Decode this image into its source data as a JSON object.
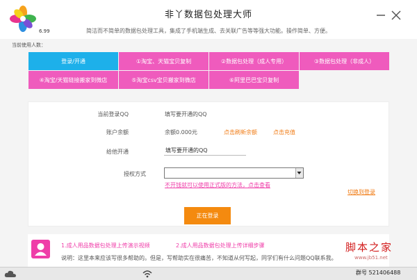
{
  "header": {
    "title": "非丫数据包处理大师",
    "version": "6.99",
    "subtitle": "简洁而不简单的数据包处理工具，集成了手机端生成、去关联广告等等强大功能。操作简单、方便。"
  },
  "online_users_label": "当前使用人数：",
  "tabs": [
    {
      "label": "登录/开通"
    },
    {
      "label": "①淘宝、天猫宝贝复制"
    },
    {
      "label": "②数据包处理（成人专用）"
    },
    {
      "label": "③数据包处理（非成人）"
    },
    {
      "label": "④淘宝/天猫链接搬家到微店"
    },
    {
      "label": "⑤淘宝csv宝贝搬家到微店"
    },
    {
      "label": "⑥阿里巴巴宝贝复制"
    }
  ],
  "form": {
    "current_login_label": "当前登录QQ",
    "current_login_value": "填写要开通的QQ",
    "balance_label": "账户余额",
    "balance_value": "余额0.000元",
    "refresh_label": "点击刷新余额",
    "recharge_label": "点击充值",
    "open_for_label": "给他开通",
    "open_for_value": "填写要开通的QQ",
    "auth_label": "授权方式",
    "hint": "不开钱就可以使用正式版的方法，点击查看",
    "switch_login": "切换到登录",
    "login_button": "正在登录"
  },
  "bottom": {
    "link1": "1.成人用品数据包处理上传演示视频",
    "link2": "2.成人用品数据包处理上传详细步骤",
    "description": "说明：这里本来应该写很多帮助的。但是，写帮助实在很痛苦，不知道从何写起，同学们有什么问题QQ联系我。"
  },
  "status": {
    "qq_group": "群号 521406488"
  },
  "watermark": {
    "title": "脚本之家",
    "url": "www.jb51.net"
  },
  "colors": {
    "active_tab": "#1db0ea",
    "tab": "#ef5bbd",
    "accent_orange": "#f48a0f",
    "accent_pink": "#ef3da8"
  }
}
